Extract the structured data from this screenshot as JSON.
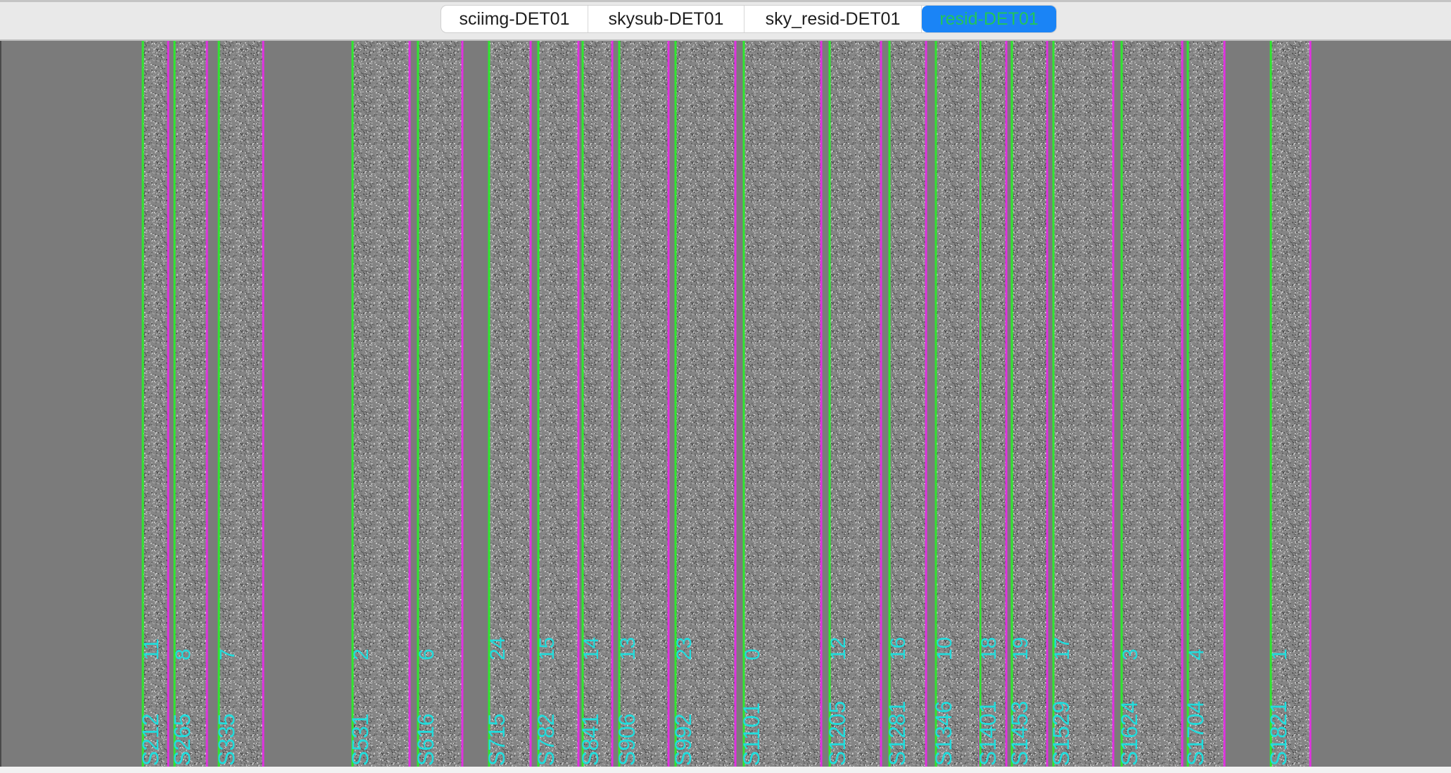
{
  "tabs": [
    {
      "label": "sciimg-DET01",
      "active": false
    },
    {
      "label": "skysub-DET01",
      "active": false
    },
    {
      "label": "sky_resid-DET01",
      "active": false
    },
    {
      "label": "resid-DET01",
      "active": true
    }
  ],
  "image": {
    "background_color": "#7b7b7b",
    "left_edge_color": "#2ee82e",
    "right_edge_color": "#e032e0",
    "label_color": "#22dcdc",
    "slits": [
      {
        "id": "S212",
        "order": "11"
      },
      {
        "id": "S265",
        "order": "8"
      },
      {
        "id": "S335",
        "order": "7"
      },
      {
        "id": "S531",
        "order": "2"
      },
      {
        "id": "S616",
        "order": "6"
      },
      {
        "id": "S715",
        "order": "24"
      },
      {
        "id": "S782",
        "order": "15"
      },
      {
        "id": "S841",
        "order": "14"
      },
      {
        "id": "S906",
        "order": "13"
      },
      {
        "id": "S992",
        "order": "23"
      },
      {
        "id": "S1101",
        "order": "0"
      },
      {
        "id": "S1205",
        "order": "12"
      },
      {
        "id": "S1281",
        "order": "16"
      },
      {
        "id": "S1346",
        "order": "10"
      },
      {
        "id": "S1401",
        "order": "18"
      },
      {
        "id": "S1453",
        "order": "19"
      },
      {
        "id": "S1529",
        "order": "17"
      },
      {
        "id": "S1624",
        "order": "3"
      },
      {
        "id": "S1704",
        "order": "4"
      },
      {
        "id": "S1821",
        "order": "1"
      }
    ]
  }
}
